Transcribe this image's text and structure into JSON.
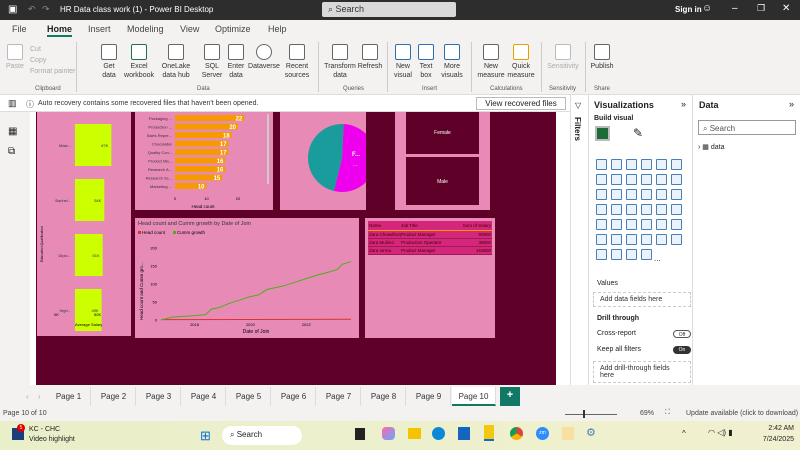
{
  "titlebar": {
    "title": "HR Data class work (1) - Power BI Desktop",
    "search": "Search",
    "signin": "Sign in"
  },
  "menu": [
    "File",
    "Home",
    "Insert",
    "Modeling",
    "View",
    "Optimize",
    "Help"
  ],
  "ribbon": {
    "clipboard": {
      "paste": "Paste",
      "cut": "Cut",
      "copy": "Copy",
      "format_painter": "Format painter",
      "group": "Clipboard"
    },
    "data": {
      "items": [
        "Get data",
        "Excel workbook",
        "OneLake data hub",
        "SQL Server",
        "Enter data",
        "Dataverse",
        "Recent sources"
      ],
      "group": "Data"
    },
    "queries": {
      "items": [
        "Transform data",
        "Refresh"
      ],
      "group": "Queries"
    },
    "insert": {
      "items": [
        "New visual",
        "Text box",
        "More visuals"
      ],
      "group": "Insert"
    },
    "calculations": {
      "items": [
        "New measure",
        "Quick measure"
      ],
      "group": "Calculations"
    },
    "sensitivity": {
      "items": [
        "Sensitivity"
      ],
      "group": "Sensitivity"
    },
    "share": {
      "items": [
        "Publish"
      ],
      "group": "Share"
    }
  },
  "notification": {
    "text": "Auto recovery contains some recovered files that haven't been opened.",
    "button": "View recovered files"
  },
  "filters_label": "Filters",
  "visualizations": {
    "title": "Visualizations",
    "build_visual": "Build visual",
    "values_label": "Values",
    "values_placeholder": "Add data fields here",
    "drill_through": "Drill through",
    "cross_report": "Cross-report",
    "cross_report_state": "Off",
    "keep_all_filters": "Keep all filters",
    "keep_state": "On",
    "drill_placeholder": "Add drill-through fields here",
    "more": "..."
  },
  "data_pane": {
    "title": "Data",
    "search_placeholder": "Search",
    "tables": [
      "data"
    ]
  },
  "slicer": {
    "items": [
      "Female",
      "Male"
    ]
  },
  "table_visual": {
    "headers": [
      "Name",
      "Job Title",
      "Sum of Salary"
    ],
    "rows": [
      [
        "Zara Chowdhury",
        "Product Manager",
        "83900"
      ],
      [
        "Zara Mulimo",
        "Production Operator",
        "38800"
      ],
      [
        "Zara Iorma",
        "Product Manager",
        "163800"
      ]
    ]
  },
  "pages": {
    "tabs": [
      "Page 1",
      "Page 2",
      "Page 3",
      "Page 4",
      "Page 5",
      "Page 6",
      "Page 7",
      "Page 8",
      "Page 9",
      "Page 10"
    ],
    "active": 9,
    "indicator": "Page 10 of 10",
    "zoom": "69%",
    "update": "Update available (click to download)"
  },
  "taskbar": {
    "notif_count": "5",
    "app": "KC - CHC",
    "sub": "Video highlight",
    "search": "Search",
    "time": "2:42 AM",
    "date": "7/24/2025"
  },
  "chart_data": [
    {
      "type": "bar",
      "orientation": "horizontal",
      "title": "",
      "categories": [
        "Mast...",
        "Bachel...",
        "Diplo...",
        "High..."
      ],
      "values": [
        67000,
        54000,
        51000,
        49000
      ],
      "labels": [
        "67K",
        "54K",
        "51K",
        "49K"
      ],
      "xlabel": "Average Salary",
      "ylabel": "Education Qualification",
      "xticks": [
        "0K",
        "50K"
      ],
      "color": "#ccff00"
    },
    {
      "type": "bar",
      "orientation": "horizontal",
      "categories": [
        "Packaging ...",
        "Production ...",
        "Sales Repre...",
        "Chocolatier",
        "Quality Con...",
        "Product Ma...",
        "Research A...",
        "Research Sc...",
        "Marketing ..."
      ],
      "values": [
        22,
        20,
        18,
        17,
        17,
        16,
        16,
        15,
        10
      ],
      "xlabel": "Head count",
      "xticks": [
        "0",
        "10",
        "20"
      ],
      "color": "#f59b00"
    },
    {
      "type": "pie",
      "categories": [
        "F...",
        "M..."
      ],
      "labels": [
        "F...",
        "..."
      ],
      "values": [
        53,
        47
      ],
      "colors": [
        "#ee00ee",
        "#1a9c9c"
      ]
    },
    {
      "type": "line",
      "title": "Head count and Cumm growth by Date of Join",
      "xlabel": "Date of Join",
      "ylabel": "Head count and Cumm gro...",
      "yticks": [
        "0",
        "50",
        "100",
        "150",
        "200"
      ],
      "xticks": [
        "2018",
        "2020",
        "2022"
      ],
      "ylim": [
        0,
        200
      ],
      "xlim": [
        2016.8,
        2023.6
      ],
      "series": [
        {
          "name": "Head count",
          "color": "#e03030",
          "x": [
            2016.8,
            2023.6
          ],
          "values": [
            1,
            2
          ]
        },
        {
          "name": "Cumm growth",
          "color": "#4caf1a",
          "x": [
            2016.8,
            2017.2,
            2017.6,
            2018.0,
            2018.4,
            2018.6,
            2018.9,
            2019.2,
            2019.6,
            2020.0,
            2020.3,
            2020.6,
            2020.9,
            2021.2,
            2021.6,
            2022.0,
            2022.4,
            2022.8,
            2023.1,
            2023.3,
            2023.6
          ],
          "values": [
            0,
            8,
            10,
            12,
            15,
            30,
            35,
            45,
            55,
            65,
            70,
            85,
            90,
            95,
            105,
            115,
            125,
            133,
            140,
            155,
            162
          ]
        }
      ]
    }
  ]
}
